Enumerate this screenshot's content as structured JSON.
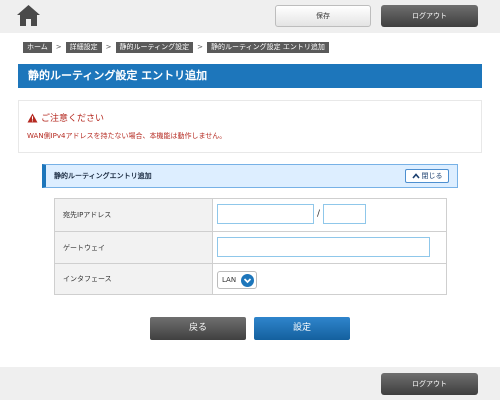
{
  "header": {
    "home_icon": "home-icon",
    "save_label": "保存",
    "logout_label": "ログアウト"
  },
  "breadcrumb": {
    "items": [
      "ホーム",
      "詳細設定",
      "静的ルーティング設定",
      "静的ルーティング設定 エントリ追加"
    ],
    "separator": ">"
  },
  "page": {
    "title": "静的ルーティング設定 エントリ追加"
  },
  "notice": {
    "icon": "warning-icon",
    "title": "ご注意ください",
    "text": "WAN側IPv4アドレスを持たない場合、本機能は動作しません。"
  },
  "section": {
    "title": "静的ルーティングエントリ追加",
    "close_label": "閉じる",
    "close_icon": "chevron-up-icon"
  },
  "form": {
    "dest_label": "宛先IPアドレス",
    "dest_ip_value": "",
    "dest_mask_value": "",
    "slash": "/",
    "gateway_label": "ゲートウェイ",
    "gateway_value": "",
    "interface_label": "インタフェース",
    "interface_value": "LAN"
  },
  "actions": {
    "back_label": "戻る",
    "submit_label": "設定"
  },
  "footer": {
    "logout_label": "ログアウト"
  },
  "colors": {
    "accent": "#1d76bb",
    "warning": "#b52a21",
    "input_border": "#8fc7ea"
  }
}
